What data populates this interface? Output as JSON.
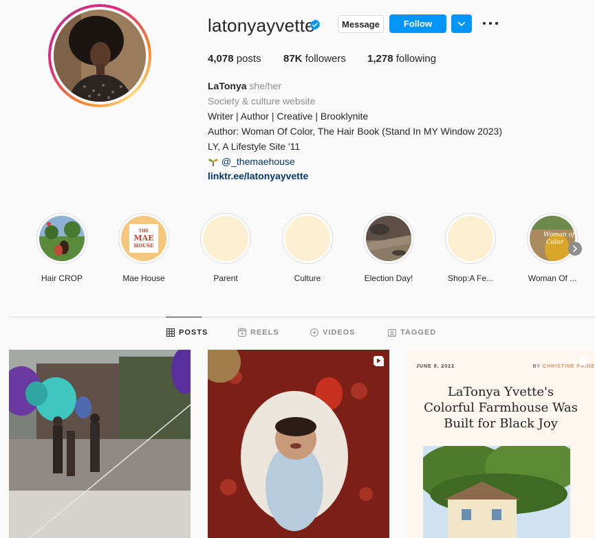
{
  "profile": {
    "username": "latonyayvette",
    "verified": true,
    "buttons": {
      "message": "Message",
      "follow": "Follow"
    },
    "stats": {
      "posts_count": "4,078",
      "posts_label": "posts",
      "followers_count": "87K",
      "followers_label": "followers",
      "following_count": "1,278",
      "following_label": "following"
    },
    "bio": {
      "name": "LaTonya",
      "pronouns": "she/her",
      "category": "Society & culture website",
      "lines": [
        "Writer | Author | Creative | Brooklynite",
        "Author: Woman Of Color, The Hair Book (Stand In MY Window 2023)",
        "LY, A Lifestyle Site '11"
      ],
      "mention": "@_themaehouse",
      "link": "linktr.ee/latonyayvette"
    }
  },
  "highlights": [
    {
      "label": "Hair CROP"
    },
    {
      "label": "Mae House",
      "image_text": "THE MAE HOUSE"
    },
    {
      "label": "Parent"
    },
    {
      "label": "Culture"
    },
    {
      "label": "Election Day!"
    },
    {
      "label": "Shop:A Fe..."
    },
    {
      "label": "Woman Of ...",
      "image_text": "Woman of Color"
    }
  ],
  "tabs": {
    "posts": "POSTS",
    "reels": "REELS",
    "videos": "VIDEOS",
    "tagged": "TAGGED",
    "active": "posts"
  },
  "posts": {
    "article": {
      "date": "JUNE 9, 2022",
      "by_prefix": "BY",
      "author": "CHRISTINE PRIDE",
      "title": "LaTonya Yvette's Colorful Farmhouse Was Built for Black Joy"
    }
  },
  "colors": {
    "follow_blue": "#0095f6",
    "link_blue": "#00376b",
    "muted": "#8e8e8e",
    "highlight_cream": "#fdf0d2"
  }
}
